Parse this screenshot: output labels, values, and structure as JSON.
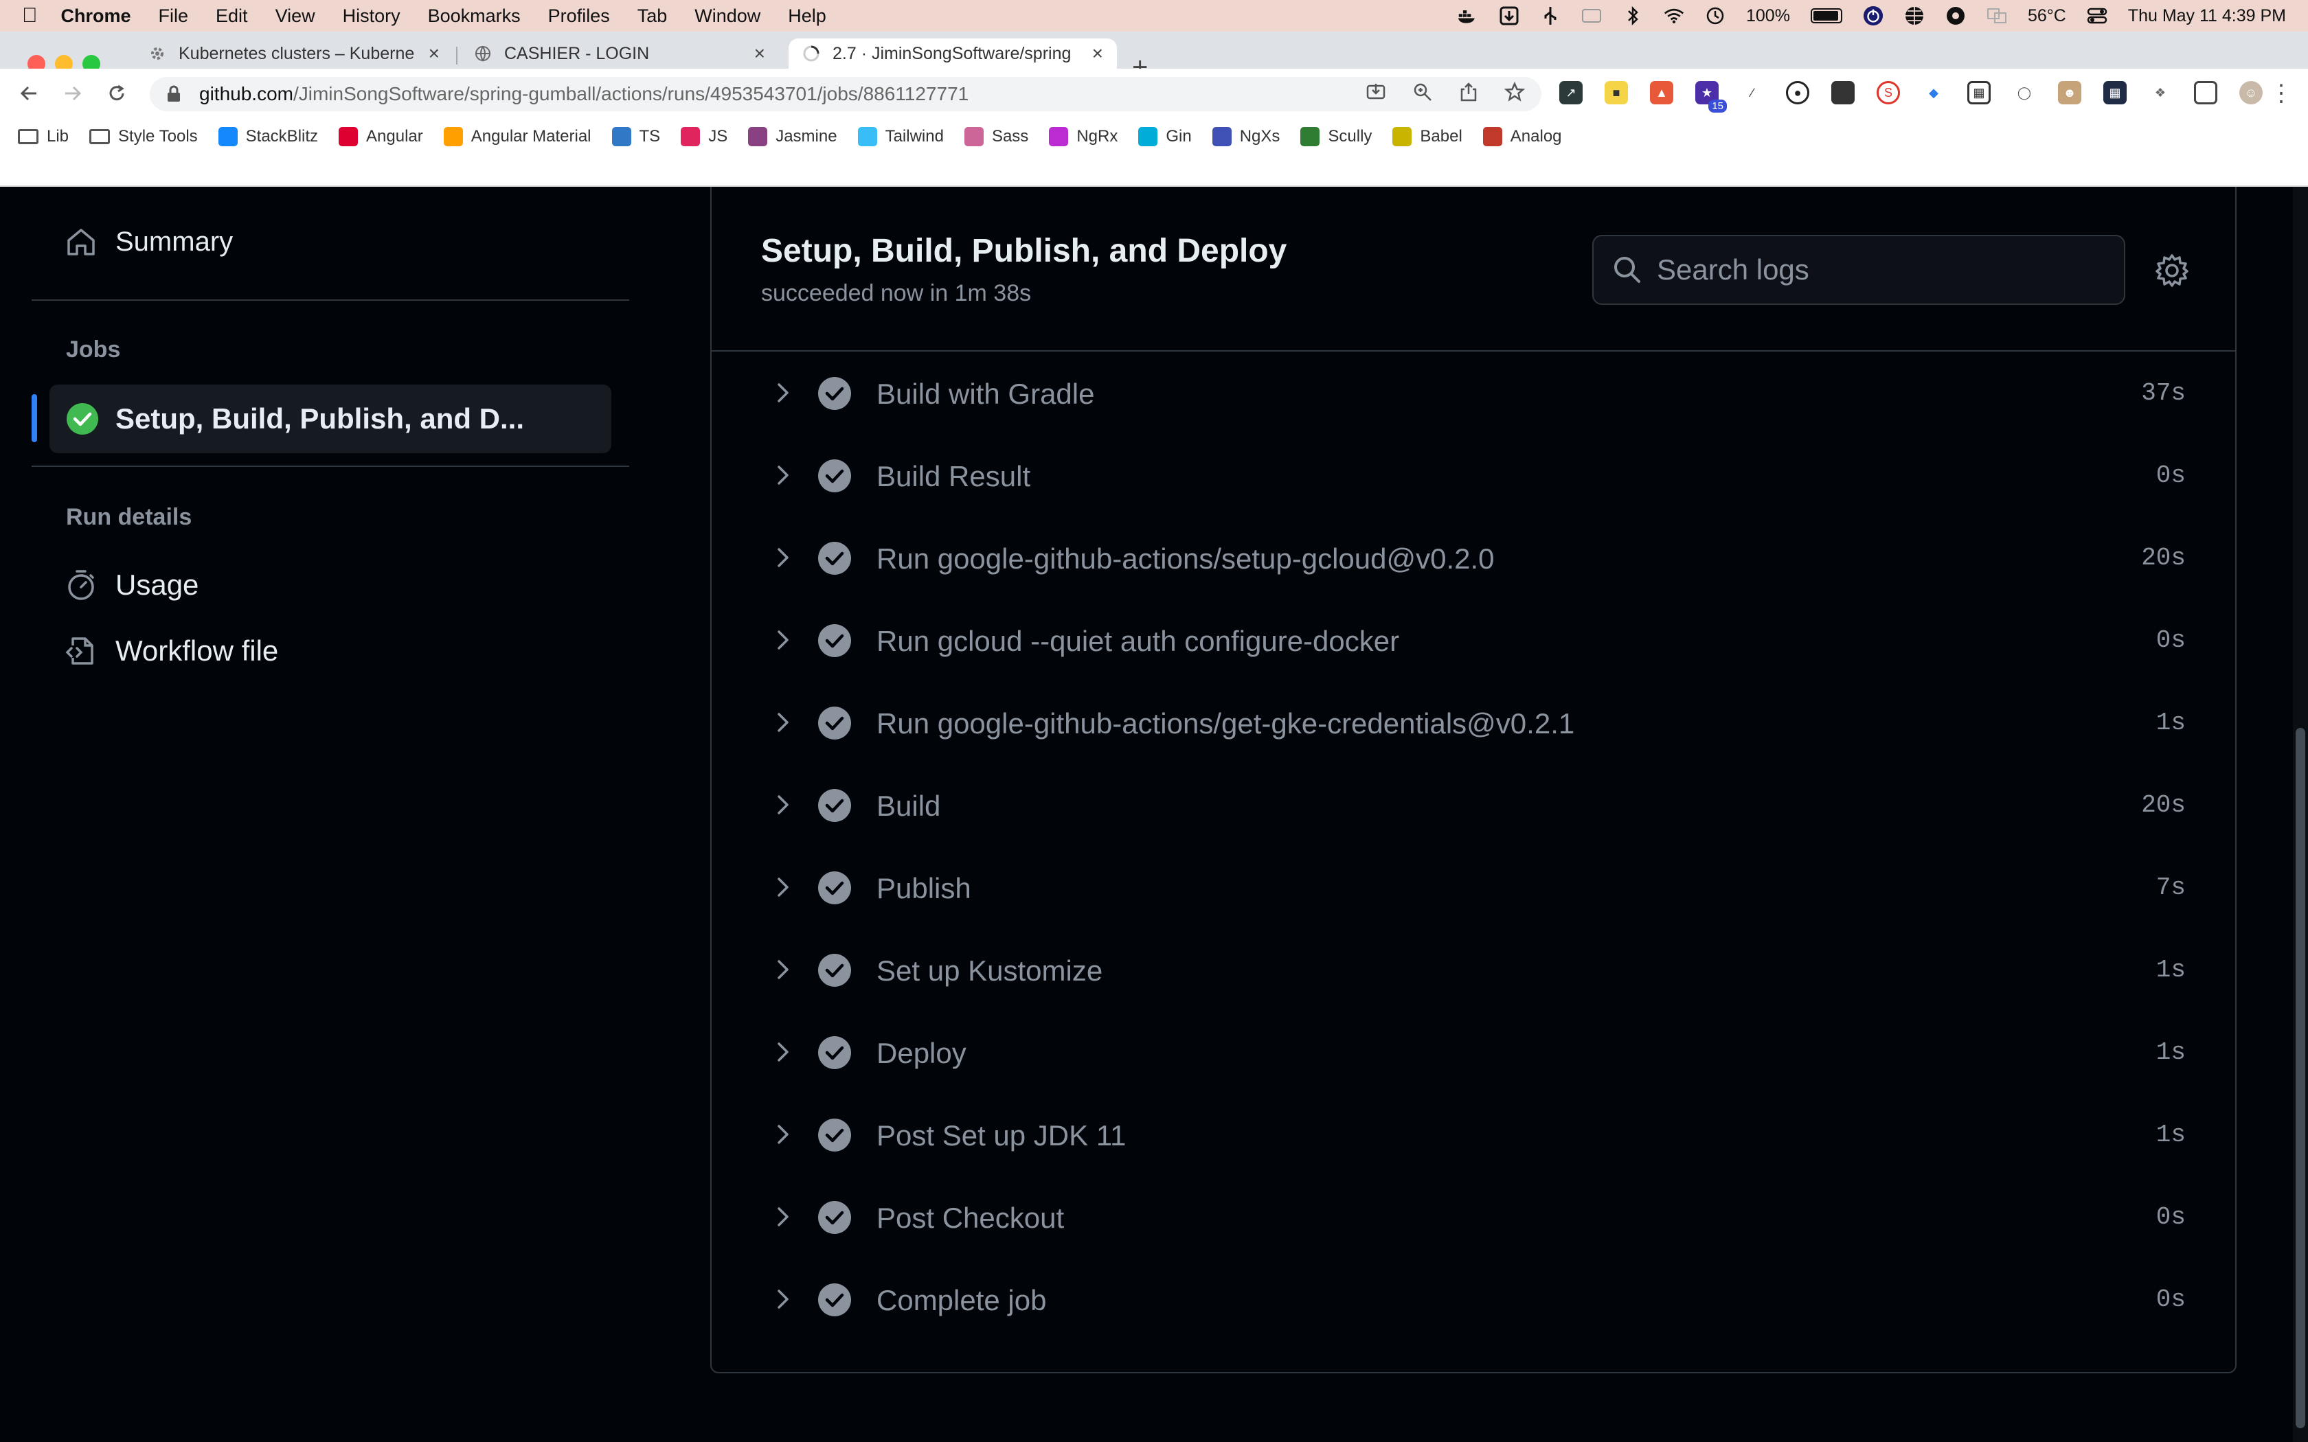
{
  "menubar": {
    "app": "Chrome",
    "items": [
      "File",
      "Edit",
      "View",
      "History",
      "Bookmarks",
      "Profiles",
      "Tab",
      "Window",
      "Help"
    ],
    "battery": "100%",
    "temperature": "56°C",
    "datetime": "Thu May 11  4:39 PM"
  },
  "tabs": [
    {
      "title": "Kubernetes clusters – Kuberne",
      "active": false
    },
    {
      "title": "CASHIER - LOGIN",
      "active": false
    },
    {
      "title": "2.7 · JiminSongSoftware/spring",
      "active": true
    }
  ],
  "address": {
    "host": "github.com",
    "path": "/JiminSongSoftware/spring-gumball/actions/runs/4953543701/jobs/8861127771"
  },
  "extensions": {
    "badge": "15"
  },
  "bookmarks": [
    {
      "label": "Lib",
      "icon": "folder-icon",
      "color": "#555555"
    },
    {
      "label": "Style Tools",
      "icon": "folder-icon",
      "color": "#555555"
    },
    {
      "label": "StackBlitz",
      "icon": "stackblitz-icon",
      "color": "#1389fd"
    },
    {
      "label": "Angular",
      "icon": "angular-icon",
      "color": "#dd0031"
    },
    {
      "label": "Angular Material",
      "icon": "angular-material-icon",
      "color": "#ffa000"
    },
    {
      "label": "TS",
      "icon": "typescript-icon",
      "color": "#3178c6"
    },
    {
      "label": "JS",
      "icon": "js-icon",
      "color": "#e0245e"
    },
    {
      "label": "Jasmine",
      "icon": "jasmine-icon",
      "color": "#8a4182"
    },
    {
      "label": "Tailwind",
      "icon": "tailwind-icon",
      "color": "#38bdf8"
    },
    {
      "label": "Sass",
      "icon": "sass-icon",
      "color": "#cc6699"
    },
    {
      "label": "NgRx",
      "icon": "ngrx-icon",
      "color": "#ba2bd2"
    },
    {
      "label": "Gin",
      "icon": "gin-icon",
      "color": "#00add8"
    },
    {
      "label": "NgXs",
      "icon": "ngxs-icon",
      "color": "#3f51b5"
    },
    {
      "label": "Scully",
      "icon": "scully-icon",
      "color": "#2e7d32"
    },
    {
      "label": "Babel",
      "icon": "babel-icon",
      "color": "#c9b500"
    },
    {
      "label": "Analog",
      "icon": "analog-icon",
      "color": "#c0392b"
    }
  ],
  "sidebar": {
    "summary": "Summary",
    "jobs_heading": "Jobs",
    "job": "Setup, Build, Publish, and D...",
    "run_details_heading": "Run details",
    "usage": "Usage",
    "workflow_file": "Workflow file"
  },
  "job": {
    "title": "Setup, Build, Publish, and Deploy",
    "status": "succeeded now in 1m 38s",
    "search_placeholder": "Search logs"
  },
  "steps": [
    {
      "name": "Build with Gradle",
      "duration": "37s"
    },
    {
      "name": "Build Result",
      "duration": "0s"
    },
    {
      "name": "Run google-github-actions/setup-gcloud@v0.2.0",
      "duration": "20s"
    },
    {
      "name": "Run gcloud --quiet auth configure-docker",
      "duration": "0s"
    },
    {
      "name": "Run google-github-actions/get-gke-credentials@v0.2.1",
      "duration": "1s"
    },
    {
      "name": "Build",
      "duration": "20s"
    },
    {
      "name": "Publish",
      "duration": "7s"
    },
    {
      "name": "Set up Kustomize",
      "duration": "1s"
    },
    {
      "name": "Deploy",
      "duration": "1s"
    },
    {
      "name": "Post Set up JDK 11",
      "duration": "1s"
    },
    {
      "name": "Post Checkout",
      "duration": "0s"
    },
    {
      "name": "Complete job",
      "duration": "0s"
    }
  ],
  "colors": {
    "success": "#3fb950",
    "accent": "#2f81f7",
    "step_check": "#8b949e"
  }
}
